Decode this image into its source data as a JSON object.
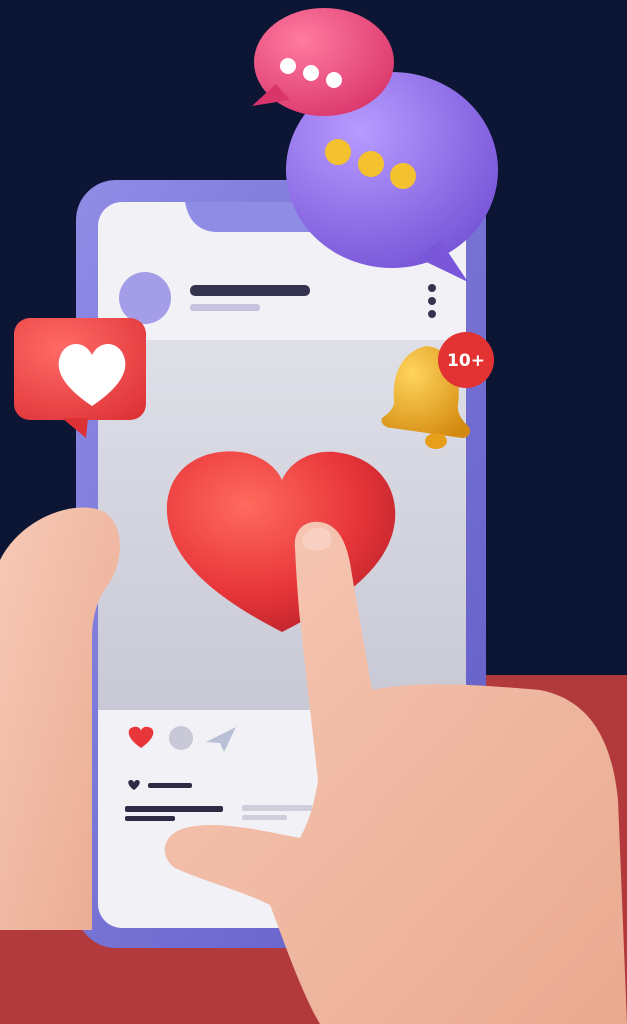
{
  "scene": {
    "background_top": "#0c1634",
    "background_bottom": "#b23a3c",
    "phone_frame_color": "#7b78d6",
    "screen_color": "#f2f2f6",
    "accent_red": "#e8363a",
    "bubble_pink": "#e94b78",
    "bubble_purple": "#8f6fe6",
    "bell_gold": "#f1b021",
    "skin": "#f2bba6"
  },
  "notification": {
    "badge_label": "10+",
    "icon": "bell-icon"
  },
  "post": {
    "avatar": "avatar-placeholder",
    "menu_icon": "vertical-dots-icon",
    "actions": [
      "heart-icon",
      "comment-icon",
      "send-icon"
    ]
  },
  "floating": {
    "like_bubble_icon": "heart-icon",
    "chat_bubble_pink_icon": "ellipsis-icon",
    "chat_bubble_purple_icon": "ellipsis-icon"
  }
}
